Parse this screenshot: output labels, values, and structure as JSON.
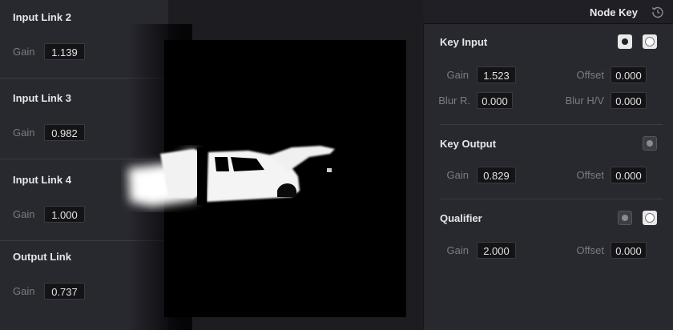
{
  "header": {
    "title": "Node Key",
    "reset_icon": "reset-history-icon"
  },
  "left_panel": {
    "sections": [
      {
        "title": "Input Link 2",
        "gain_label": "Gain",
        "gain_value": "1.139"
      },
      {
        "title": "Input Link 3",
        "gain_label": "Gain",
        "gain_value": "0.982"
      },
      {
        "title": "Input Link 4",
        "gain_label": "Gain",
        "gain_value": "1.000"
      },
      {
        "title": "Output Link",
        "gain_label": "Gain",
        "gain_value": "0.737"
      }
    ]
  },
  "key_input": {
    "title": "Key Input",
    "gain_label": "Gain",
    "gain_value": "1.523",
    "offset_label": "Offset",
    "offset_value": "0.000",
    "blur_r_label": "Blur R.",
    "blur_r_value": "0.000",
    "blur_hv_label": "Blur H/V",
    "blur_hv_value": "0.000"
  },
  "key_output": {
    "title": "Key Output",
    "gain_label": "Gain",
    "gain_value": "0.829",
    "offset_label": "Offset",
    "offset_value": "0.000"
  },
  "qualifier": {
    "title": "Qualifier",
    "gain_label": "Gain",
    "gain_value": "2.000",
    "offset_label": "Offset",
    "offset_value": "0.000"
  },
  "colors": {
    "panel": "#28282f",
    "field": "#141417",
    "viewer": "#000000",
    "text": "#e6e6ea",
    "muted": "#7b7b83"
  }
}
